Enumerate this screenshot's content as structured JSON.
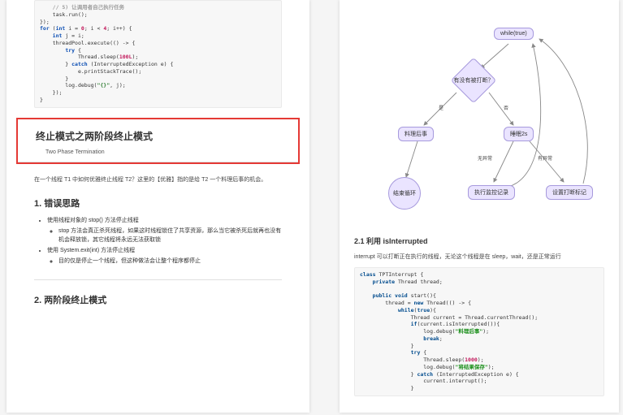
{
  "left": {
    "code": "    // 5) 让调用者自己执行任务\n    task.run();\n});\nfor (int i = 0; i < 4; i++) {\n    int j = i;\n    threadPool.execute(() -> {\n        try {\n            Thread.sleep(100L);\n        } catch (InterruptedException e) {\n            e.printStackTrace();\n        }\n        log.debug(\"{}\", j);\n    });\n}",
    "h1": "终止模式之两阶段终止模式",
    "subtitle": "Two Phase Termination",
    "intro": "在一个线程 T1 中如何优雅终止线程 T2？这里的【优雅】指的是给 T2 一个料理后事的机会。",
    "h2a": "1. 错误思路",
    "bullets": {
      "b1": "使用线程对象的 stop() 方法停止线程",
      "b1a": "stop 方法会真正杀死线程，如果这时线程锁住了共享资源，那么当它被杀死后就再也没有机会释放锁，其它线程将永远无法获取锁",
      "b2": "使用 System.exit(int) 方法停止线程",
      "b2a": "目的仅是停止一个线程，但这种做法会让整个程序都停止"
    },
    "h2b": "2. 两阶段终止模式"
  },
  "right": {
    "flow": {
      "while": "while(true)",
      "check": "有没有被打断？",
      "yes": "是",
      "no": "否",
      "after": "料理后事",
      "sleep": "睡眠2s",
      "noex": "无异常",
      "hasex": "有异常",
      "endloop": "结束循环",
      "log": "执行监控记录",
      "setflag": "设置打断标记"
    },
    "h3": "2.1 利用 isInterrupted",
    "desc": "interrupt 可以打断正在执行的线程，无论这个线程是在 sleep，wait，还是正常运行",
    "code": "class TPTInterrupt {\n    private Thread thread;\n\n    public void start(){\n        thread = new Thread(() -> {\n            while(true){\n                Thread current = Thread.currentThread();\n                if(current.isInterrupted()){\n                    log.debug(\"料理后事\");\n                    break;\n                }\n                try {\n                    Thread.sleep(1000);\n                    log.debug(\"将结果保存\");\n                } catch (InterruptedException e) {\n                    current.interrupt();\n                }"
  }
}
